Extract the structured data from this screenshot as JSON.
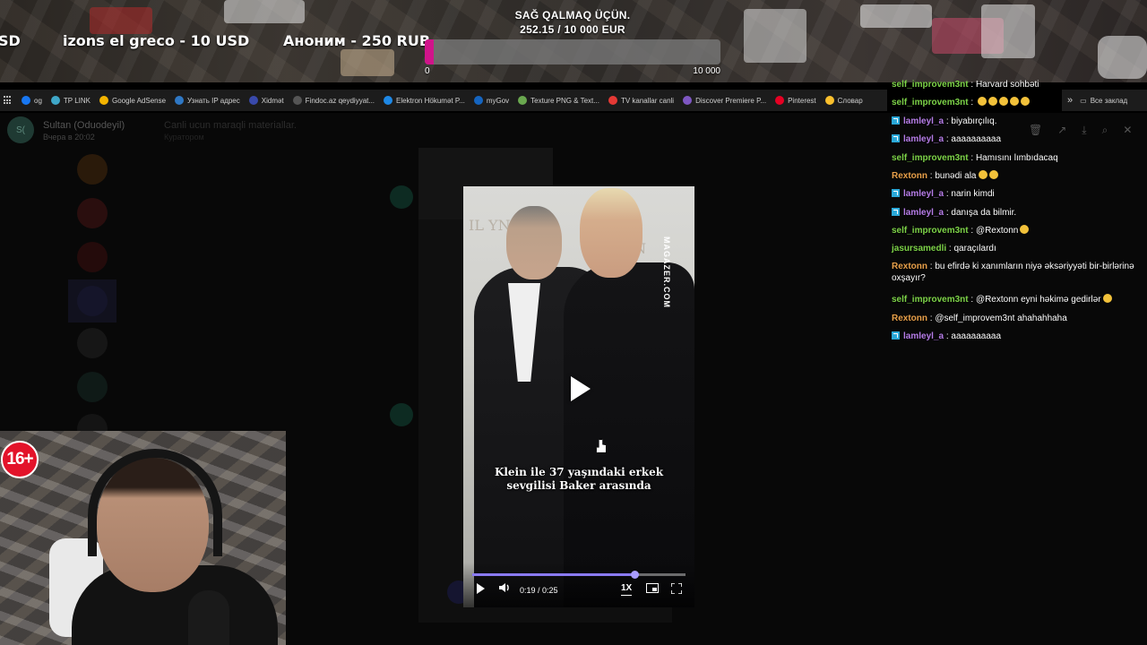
{
  "banner": {
    "ticker": [
      {
        "text": "SD"
      },
      {
        "text": "izons el greco - 10 USD"
      },
      {
        "text": "Аноним - 250 RUB"
      }
    ],
    "goal": {
      "title": "SAĞ QALMAQ ÜÇÜN.",
      "amount_text": "252.15 / 10 000 EUR",
      "current": 252.15,
      "target": 10000,
      "min_label": "0",
      "max_label": "10 000",
      "fill_color": "#d0148a"
    }
  },
  "bookmarks": {
    "items": [
      {
        "label": "og",
        "icon_color": "#1877f2"
      },
      {
        "label": "TP LINK",
        "icon_color": "#3fa7c8"
      },
      {
        "label": "Google AdSense",
        "icon_color": "#f4b400"
      },
      {
        "label": "Узнать IP адрес",
        "icon_color": "#2f78c4"
      },
      {
        "label": "Xidmət",
        "icon_color": "#3949ab"
      },
      {
        "label": "Findoc.az qeydiyyat...",
        "icon_color": "#555"
      },
      {
        "label": "Elektron Hökumət P...",
        "icon_color": "#1e88e5"
      },
      {
        "label": "myGov",
        "icon_color": "#1565c0"
      },
      {
        "label": "Texture PNG & Text...",
        "icon_color": "#6aa84f"
      },
      {
        "label": "TV kanallar canli",
        "icon_color": "#e53935"
      },
      {
        "label": "Discover Premiere P...",
        "icon_color": "#7e57c2"
      },
      {
        "label": "Pinterest",
        "icon_color": "#e60023"
      },
      {
        "label": "Словар",
        "icon_color": "#fbc02d"
      }
    ],
    "more_label": "»",
    "all_bookmarks": "Все заклад"
  },
  "messenger": {
    "chat_avatar_initials": "S(",
    "chat_name": "Sultan (Oduodeyil)",
    "chat_time": "Вчера в 20:02",
    "channel_title": "Canli ucun maraqli materiallar.",
    "channel_sub": "Куратором"
  },
  "video": {
    "caption_line1": "Klein ile 37 yaşındaki erkek",
    "caption_line2": "sevgilisi Baker arasında",
    "watermark": "MAGAZER.COM",
    "current_time": "0:19",
    "duration": "0:25",
    "time_text": "0:19 / 0:25",
    "progress_fraction": 0.76,
    "speed_label": "1X",
    "progress_color": "#8a7af5"
  },
  "chat": {
    "messages": [
      {
        "user": "self_improvem3nt",
        "color": "#7dd348",
        "badge": false,
        "text": "Harvard sohbəti",
        "emojis": 0
      },
      {
        "user": "self_improvem3nt",
        "color": "#7dd348",
        "badge": false,
        "text": "",
        "emojis": 5
      },
      {
        "user": "lamleyl_a",
        "color": "#b67de8",
        "badge": true,
        "text": "biyabırçılıq.",
        "emojis": 0
      },
      {
        "user": "lamleyl_a",
        "color": "#b67de8",
        "badge": true,
        "text": "aaaaaaaaaa",
        "emojis": 0
      },
      {
        "user": "self_improvem3nt",
        "color": "#7dd348",
        "badge": false,
        "text": "Hamısını lımbıdacaq",
        "emojis": 0
      },
      {
        "user": "Rextonn",
        "color": "#e8a04a",
        "badge": false,
        "text": "bunədi ala",
        "emojis": 2
      },
      {
        "user": "lamleyl_a",
        "color": "#b67de8",
        "badge": true,
        "text": "narin kimdi",
        "emojis": 0
      },
      {
        "user": "lamleyl_a",
        "color": "#b67de8",
        "badge": true,
        "text": "danışa da bilmir.",
        "emojis": 0
      },
      {
        "user": "self_improvem3nt",
        "color": "#7dd348",
        "badge": false,
        "text": "@Rextonn",
        "emojis": 1
      },
      {
        "user": "jasursamedli",
        "color": "#7dd348",
        "badge": false,
        "text": "qaraçılardı",
        "emojis": 0
      },
      {
        "user": "Rextonn",
        "color": "#e8a04a",
        "badge": false,
        "text": "bu efirdə ki xanımların niyə əksəriyyəti bir-birlərinə oxşayır?",
        "emojis": 0
      },
      {
        "user": "self_improvem3nt",
        "color": "#7dd348",
        "badge": false,
        "text": "@Rextonn eyni həkimə gedirlər",
        "emojis": 1
      },
      {
        "user": "Rextonn",
        "color": "#e8a04a",
        "badge": false,
        "text": "@self_improvem3nt ahahahhaha",
        "emojis": 0
      },
      {
        "user": "lamleyl_a",
        "color": "#b67de8",
        "badge": true,
        "text": "aaaaaaaaaa",
        "emojis": 0
      }
    ]
  },
  "webcam": {
    "age_rating": "16+"
  }
}
